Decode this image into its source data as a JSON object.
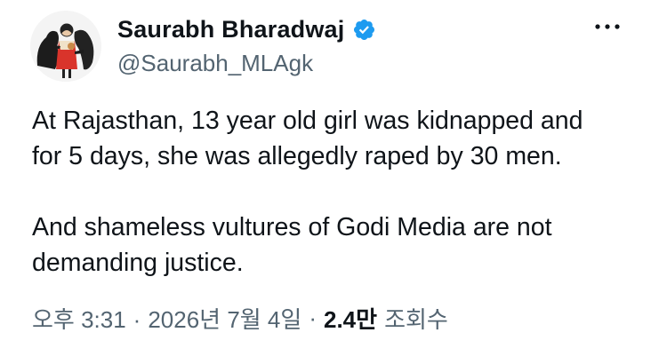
{
  "author": {
    "display_name": "Saurabh Bharadwaj",
    "handle": "@Saurabh_MLAgk",
    "verified": true,
    "avatar_icon": "profile-illustration"
  },
  "tweet": {
    "paragraphs": [
      [
        "At Rajasthan, 13 year old girl was kidnapped and",
        "for 5 days, she was allegedly raped by 30 men."
      ],
      [
        "And shameless vultures of Godi Media are not",
        "demanding justice."
      ]
    ]
  },
  "meta": {
    "time": "오후 3:31",
    "separator": "·",
    "date": "2026년 7월 4일",
    "views_count": "2.4만",
    "views_label": "조회수"
  },
  "more_icon": "more-horizontal",
  "colors": {
    "text": "#0f1419",
    "secondary": "#536471",
    "verified_badge": "#1d9bf0"
  }
}
